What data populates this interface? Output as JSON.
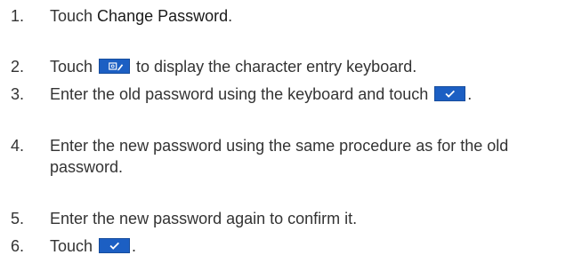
{
  "steps": [
    {
      "number": "1.",
      "before": "Touch ",
      "emphasis": "Change Password",
      "after": "."
    },
    {
      "number": "2.",
      "before": "Touch ",
      "icon": "edit-keyboard-icon",
      "after": " to display the character entry keyboard."
    },
    {
      "number": "3.",
      "before": "Enter the old password using the keyboard and touch ",
      "icon": "checkmark-icon",
      "after": "."
    },
    {
      "number": "4.",
      "line1": "Enter the new password using the same procedure as for the old",
      "line2": "password."
    },
    {
      "number": "5.",
      "text": "Enter the new password again to confirm it."
    },
    {
      "number": "6.",
      "before": "Touch ",
      "icon": "checkmark-icon",
      "after": "."
    }
  ],
  "colors": {
    "text": "#333333",
    "icon_bg": "#1c5fc3",
    "icon_fg": "#ffffff"
  }
}
